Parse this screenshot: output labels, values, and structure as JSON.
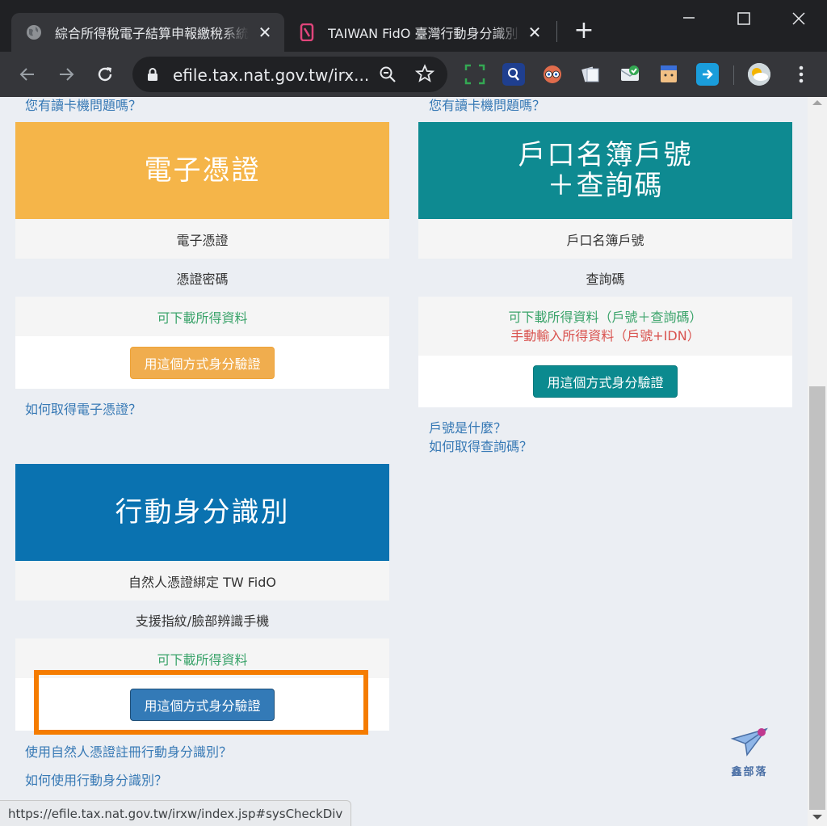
{
  "browser": {
    "tabs": [
      {
        "title": "綜合所得稅電子結算申報繳稅系統",
        "active": true
      },
      {
        "title": "TAIWAN FidO 臺灣行動身分識別",
        "active": false
      }
    ],
    "url": "efile.tax.nat.gov.tw/irx...",
    "status_url": "https://efile.tax.nat.gov.tw/irxw/index.jsp#sysCheckDiv"
  },
  "page": {
    "top_links": {
      "left": "您有讀卡機問題嗎？",
      "right": "您有讀卡機問題嗎？"
    },
    "cards": {
      "cert": {
        "banner": "電子憑證",
        "banner_color": "#f5b549",
        "row1": "電子憑證",
        "row2": "憑證密碼",
        "download": "可下載所得資料",
        "button": "用這個方式身分驗證",
        "link1": "如何取得電子憑證？"
      },
      "household": {
        "banner_line1": "戶口名簿戶號",
        "banner_line2": "＋查詢碼",
        "banner_color": "#0e8a91",
        "row1": "戶口名簿戶號",
        "row2": "查詢碼",
        "download": "可下載所得資料（戶號＋查詢碼）",
        "manual": "手動輸入所得資料（戶號+IDN）",
        "button": "用這個方式身分驗證",
        "link1": "戶號是什麼？",
        "link2": "如何取得查詢碼？"
      },
      "mobile": {
        "banner": "行動身分識別",
        "banner_color": "#0a72b0",
        "row1": "自然人憑證綁定 TW FidO",
        "row2": "支援指紋/臉部辨識手機",
        "download": "可下載所得資料",
        "button": "用這個方式身分驗證",
        "link1": "使用自然人憑證註冊行動身分識別？",
        "link2": "如何使用行動身分識別？"
      }
    },
    "watermark": "鑫部落"
  }
}
